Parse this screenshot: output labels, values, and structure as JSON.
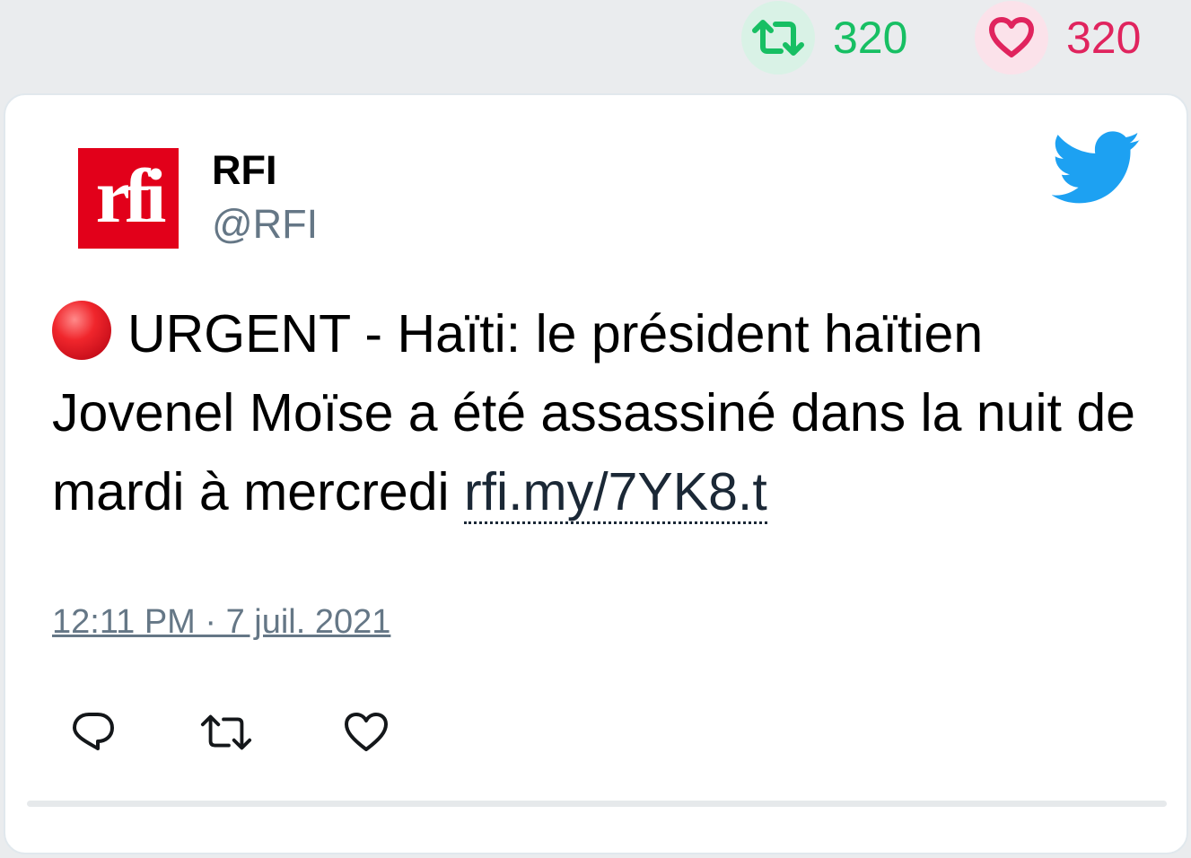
{
  "stats": {
    "retweets": "320",
    "likes": "320"
  },
  "tweet": {
    "author_name": "RFI",
    "author_handle": "@RFI",
    "logo_text": "rfi",
    "text": "URGENT - Haïti: le président haïtien Jovenel Moïse a été assassiné dans la nuit de mardi à mercredi ",
    "link_text": "rfi.my/7YK8.t",
    "timestamp": "12:11 PM · 7 juil. 2021"
  },
  "icons": {
    "stat_retweet": "retweet-icon",
    "stat_like": "heart-icon",
    "brand": "twitter-bird-icon",
    "urgent": "red-circle-emoji",
    "action_reply": "reply-icon",
    "action_retweet": "retweet-icon",
    "action_like": "heart-icon"
  },
  "colors": {
    "retweet_green": "#17bf63",
    "like_red": "#e0245e",
    "twitter_blue": "#1da1f2",
    "rfi_red": "#e2001a",
    "secondary_text": "#657786"
  }
}
